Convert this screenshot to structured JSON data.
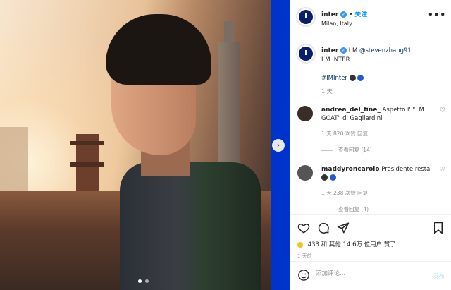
{
  "post": {
    "carousel_count": 2,
    "carousel_active": 1
  },
  "header": {
    "username": "inter",
    "separator": "•",
    "follow_label": "关注",
    "location": "Milan, Italy",
    "more": "•••"
  },
  "caption": {
    "username": "inter",
    "text_prefix": "I M ",
    "mention": "@stevenzhang91",
    "line2": "I M INTER",
    "hashtag": "#IMInter",
    "time": "1 天"
  },
  "comments": [
    {
      "username": "andrea_del_fine_",
      "text": "Aspetto l' \"I M GOAT\" di Gagliardini",
      "meta": "1 天   820 次赞   回复",
      "replies": "查看回复 (14)"
    },
    {
      "username": "maddyroncarolo",
      "text": "Presidente resta",
      "meta": "1 天   238 次赞   回复",
      "replies": "查看回复 (4)"
    }
  ],
  "likes": {
    "count_text": "433",
    "others_text": "和 其他 14.6万 位用户 赞了"
  },
  "post_time": "1 天前",
  "add_comment": {
    "placeholder": "添加评论...",
    "post_label": "发布"
  },
  "icons": {
    "next": "chevron-right-icon",
    "like": "heart-icon",
    "comment": "comment-icon",
    "share": "share-icon",
    "save": "bookmark-icon",
    "emoji": "emoji-icon"
  },
  "colors": {
    "background": "#0033cc",
    "link": "#00376b",
    "follow": "#0095f6"
  }
}
